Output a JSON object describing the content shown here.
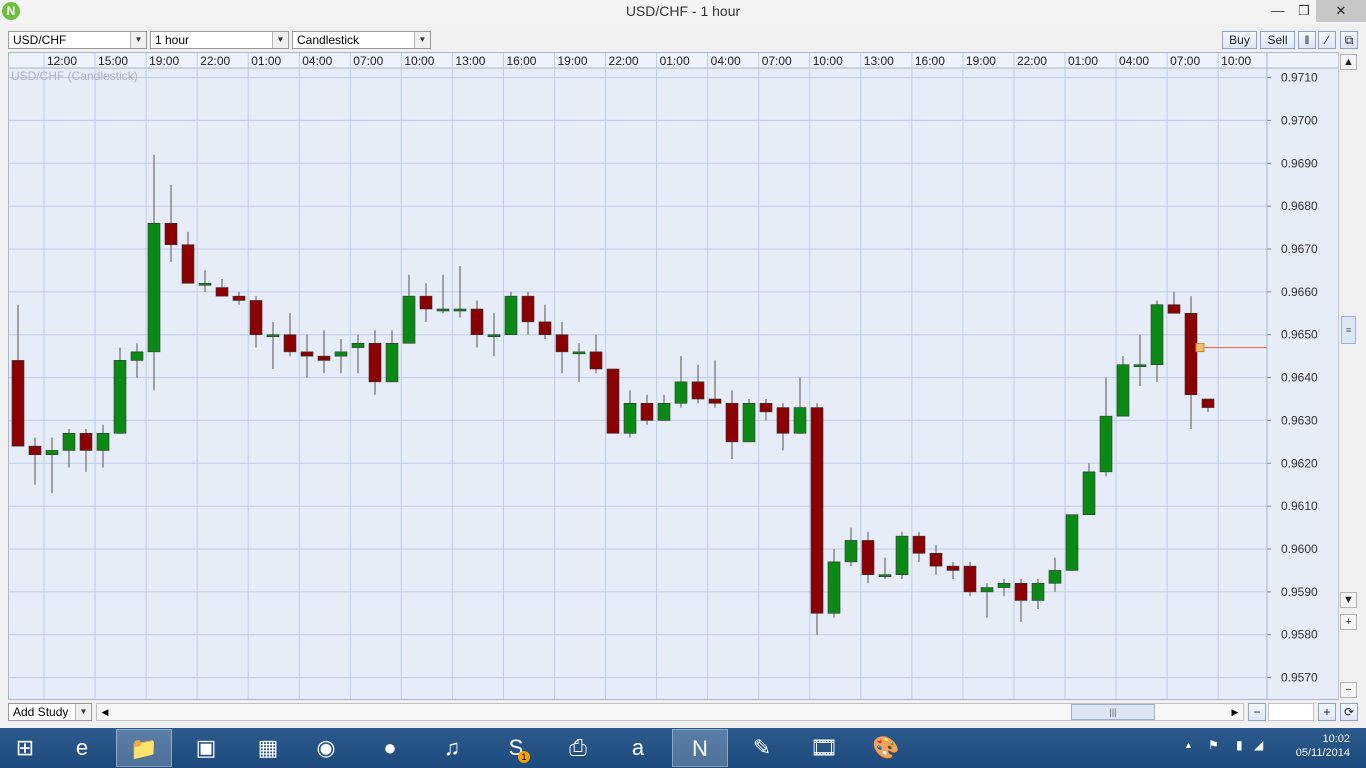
{
  "window": {
    "title": "USD/CHF - 1 hour"
  },
  "toolbar": {
    "instrument": "USD/CHF",
    "timeframe": "1 hour",
    "chart_type": "Candlestick",
    "buy_label": "Buy",
    "sell_label": "Sell"
  },
  "chart_label": "USD/CHF (Candlestick)",
  "bottom": {
    "add_study_label": "Add Study"
  },
  "taskbar": {
    "apps": [
      "windows-start",
      "internet-explorer",
      "file-explorer",
      "photo-app",
      "store",
      "chrome",
      "firefox",
      "music-app",
      "skype",
      "remote-app",
      "amazon",
      "nadex-app",
      "edit-app",
      "movie-maker",
      "paint-app"
    ],
    "skype_badge": "1",
    "time": "10:02",
    "date": "05/11/2014"
  },
  "colors": {
    "up": "#0a8a14",
    "down": "#8b0000",
    "grid": "#bfcde6",
    "background": "#e6ecf8",
    "current_price_line": "#e8642c"
  },
  "chart_data": {
    "type": "candlestick",
    "title": "USD/CHF (Candlestick)",
    "ylim": [
      0.9565,
      0.9712
    ],
    "yticks": [
      0.971,
      0.97,
      0.969,
      0.968,
      0.967,
      0.966,
      0.965,
      0.964,
      0.963,
      0.962,
      0.961,
      0.96,
      0.959,
      0.958,
      0.957
    ],
    "ytick_labels": [
      "0.9710",
      "0.9700",
      "0.9690",
      "0.9680",
      "0.9670",
      "0.9660",
      "0.9650",
      "0.9640",
      "0.9630",
      "0.9620",
      "0.9610",
      "0.9600",
      "0.9590",
      "0.9580",
      "0.9570"
    ],
    "xtick_labels": [
      "12:00",
      "15:00",
      "19:00",
      "22:00",
      "01:00",
      "04:00",
      "07:00",
      "10:00",
      "13:00",
      "16:00",
      "19:00",
      "22:00",
      "01:00",
      "04:00",
      "07:00",
      "10:00",
      "13:00",
      "16:00",
      "19:00",
      "22:00",
      "01:00",
      "04:00",
      "07:00",
      "10:00"
    ],
    "current_price": 0.9647,
    "candles": [
      {
        "o": 0.9644,
        "h": 0.9657,
        "l": 0.9624,
        "c": 0.9624
      },
      {
        "o": 0.9624,
        "h": 0.9626,
        "l": 0.9615,
        "c": 0.9622
      },
      {
        "o": 0.9622,
        "h": 0.9626,
        "l": 0.9613,
        "c": 0.9623
      },
      {
        "o": 0.9623,
        "h": 0.9628,
        "l": 0.9619,
        "c": 0.9627
      },
      {
        "o": 0.9627,
        "h": 0.9628,
        "l": 0.9618,
        "c": 0.9623
      },
      {
        "o": 0.9623,
        "h": 0.9629,
        "l": 0.9619,
        "c": 0.9627
      },
      {
        "o": 0.9627,
        "h": 0.9647,
        "l": 0.9627,
        "c": 0.9644
      },
      {
        "o": 0.9644,
        "h": 0.9648,
        "l": 0.964,
        "c": 0.9646
      },
      {
        "o": 0.9646,
        "h": 0.9692,
        "l": 0.9637,
        "c": 0.9676
      },
      {
        "o": 0.9676,
        "h": 0.9685,
        "l": 0.9667,
        "c": 0.9671
      },
      {
        "o": 0.9671,
        "h": 0.9674,
        "l": 0.9662,
        "c": 0.9662
      },
      {
        "o": 0.9662,
        "h": 0.9665,
        "l": 0.966,
        "c": 0.9662
      },
      {
        "o": 0.9661,
        "h": 0.9663,
        "l": 0.9659,
        "c": 0.9659
      },
      {
        "o": 0.9659,
        "h": 0.966,
        "l": 0.9657,
        "c": 0.9658
      },
      {
        "o": 0.9658,
        "h": 0.9659,
        "l": 0.9647,
        "c": 0.965
      },
      {
        "o": 0.965,
        "h": 0.9653,
        "l": 0.9642,
        "c": 0.965
      },
      {
        "o": 0.965,
        "h": 0.9655,
        "l": 0.9645,
        "c": 0.9646
      },
      {
        "o": 0.9646,
        "h": 0.965,
        "l": 0.964,
        "c": 0.9645
      },
      {
        "o": 0.9645,
        "h": 0.9651,
        "l": 0.9641,
        "c": 0.9644
      },
      {
        "o": 0.9645,
        "h": 0.9649,
        "l": 0.9641,
        "c": 0.9646
      },
      {
        "o": 0.9647,
        "h": 0.965,
        "l": 0.9641,
        "c": 0.9648
      },
      {
        "o": 0.9648,
        "h": 0.9651,
        "l": 0.9636,
        "c": 0.9639
      },
      {
        "o": 0.9639,
        "h": 0.9651,
        "l": 0.9639,
        "c": 0.9648
      },
      {
        "o": 0.9648,
        "h": 0.9664,
        "l": 0.9648,
        "c": 0.9659
      },
      {
        "o": 0.9659,
        "h": 0.9662,
        "l": 0.9653,
        "c": 0.9656
      },
      {
        "o": 0.9656,
        "h": 0.9664,
        "l": 0.9655,
        "c": 0.9656
      },
      {
        "o": 0.9656,
        "h": 0.9666,
        "l": 0.9654,
        "c": 0.9656
      },
      {
        "o": 0.9656,
        "h": 0.9658,
        "l": 0.9647,
        "c": 0.965
      },
      {
        "o": 0.965,
        "h": 0.9655,
        "l": 0.9645,
        "c": 0.965
      },
      {
        "o": 0.965,
        "h": 0.966,
        "l": 0.965,
        "c": 0.9659
      },
      {
        "o": 0.9659,
        "h": 0.966,
        "l": 0.965,
        "c": 0.9653
      },
      {
        "o": 0.9653,
        "h": 0.9657,
        "l": 0.9649,
        "c": 0.965
      },
      {
        "o": 0.965,
        "h": 0.9653,
        "l": 0.9641,
        "c": 0.9646
      },
      {
        "o": 0.9646,
        "h": 0.9648,
        "l": 0.9639,
        "c": 0.9646
      },
      {
        "o": 0.9646,
        "h": 0.965,
        "l": 0.9641,
        "c": 0.9642
      },
      {
        "o": 0.9642,
        "h": 0.9642,
        "l": 0.9627,
        "c": 0.9627
      },
      {
        "o": 0.9627,
        "h": 0.9637,
        "l": 0.9626,
        "c": 0.9634
      },
      {
        "o": 0.9634,
        "h": 0.9636,
        "l": 0.9629,
        "c": 0.963
      },
      {
        "o": 0.963,
        "h": 0.9636,
        "l": 0.963,
        "c": 0.9634
      },
      {
        "o": 0.9634,
        "h": 0.9645,
        "l": 0.9633,
        "c": 0.9639
      },
      {
        "o": 0.9639,
        "h": 0.9643,
        "l": 0.9634,
        "c": 0.9635
      },
      {
        "o": 0.9635,
        "h": 0.9644,
        "l": 0.9633,
        "c": 0.9634
      },
      {
        "o": 0.9634,
        "h": 0.9637,
        "l": 0.9621,
        "c": 0.9625
      },
      {
        "o": 0.9625,
        "h": 0.9635,
        "l": 0.9625,
        "c": 0.9634
      },
      {
        "o": 0.9634,
        "h": 0.9635,
        "l": 0.963,
        "c": 0.9632
      },
      {
        "o": 0.9633,
        "h": 0.9634,
        "l": 0.9623,
        "c": 0.9627
      },
      {
        "o": 0.9627,
        "h": 0.964,
        "l": 0.9627,
        "c": 0.9633
      },
      {
        "o": 0.9633,
        "h": 0.9634,
        "l": 0.958,
        "c": 0.9585
      },
      {
        "o": 0.9585,
        "h": 0.96,
        "l": 0.9584,
        "c": 0.9597
      },
      {
        "o": 0.9597,
        "h": 0.9605,
        "l": 0.9596,
        "c": 0.9602
      },
      {
        "o": 0.9602,
        "h": 0.9604,
        "l": 0.9592,
        "c": 0.9594
      },
      {
        "o": 0.9594,
        "h": 0.9598,
        "l": 0.9593,
        "c": 0.9594
      },
      {
        "o": 0.9594,
        "h": 0.9604,
        "l": 0.9593,
        "c": 0.9603
      },
      {
        "o": 0.9603,
        "h": 0.9604,
        "l": 0.9597,
        "c": 0.9599
      },
      {
        "o": 0.9599,
        "h": 0.9601,
        "l": 0.9594,
        "c": 0.9596
      },
      {
        "o": 0.9596,
        "h": 0.9597,
        "l": 0.9593,
        "c": 0.9595
      },
      {
        "o": 0.9596,
        "h": 0.9597,
        "l": 0.9589,
        "c": 0.959
      },
      {
        "o": 0.959,
        "h": 0.9592,
        "l": 0.9584,
        "c": 0.9591
      },
      {
        "o": 0.9591,
        "h": 0.9593,
        "l": 0.9589,
        "c": 0.9592
      },
      {
        "o": 0.9592,
        "h": 0.9593,
        "l": 0.9583,
        "c": 0.9588
      },
      {
        "o": 0.9588,
        "h": 0.9593,
        "l": 0.9586,
        "c": 0.9592
      },
      {
        "o": 0.9592,
        "h": 0.9598,
        "l": 0.959,
        "c": 0.9595
      },
      {
        "o": 0.9595,
        "h": 0.9608,
        "l": 0.9595,
        "c": 0.9608
      },
      {
        "o": 0.9608,
        "h": 0.962,
        "l": 0.9608,
        "c": 0.9618
      },
      {
        "o": 0.9618,
        "h": 0.964,
        "l": 0.9617,
        "c": 0.9631
      },
      {
        "o": 0.9631,
        "h": 0.9645,
        "l": 0.9631,
        "c": 0.9643
      },
      {
        "o": 0.9643,
        "h": 0.965,
        "l": 0.9638,
        "c": 0.9643
      },
      {
        "o": 0.9643,
        "h": 0.9658,
        "l": 0.9639,
        "c": 0.9657
      },
      {
        "o": 0.9657,
        "h": 0.966,
        "l": 0.9655,
        "c": 0.9655
      },
      {
        "o": 0.9655,
        "h": 0.9659,
        "l": 0.9628,
        "c": 0.9636
      },
      {
        "o": 0.9635,
        "h": 0.9635,
        "l": 0.9632,
        "c": 0.9633
      }
    ]
  }
}
